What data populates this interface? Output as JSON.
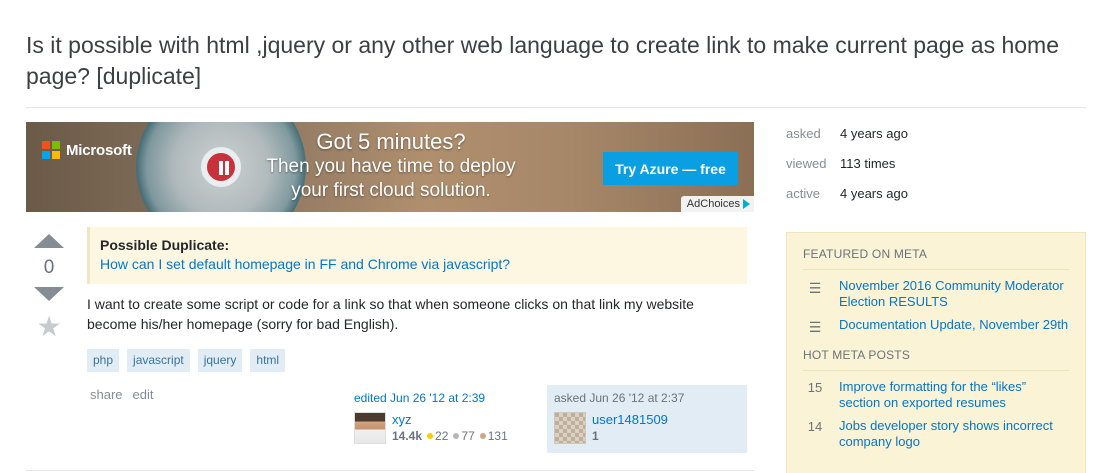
{
  "question": {
    "title": "Is it possible with html ,jquery or any other web language to create link to make current page as home page? [duplicate]",
    "votes": "0",
    "duplicate_label": "Possible Duplicate:",
    "duplicate_link": "How can I set default homepage in FF and Chrome via javascript?",
    "body": "I want to create some script or code for a link so that when someone clicks on that link my website become his/her homepage (sorry for bad English).",
    "tags": [
      "php",
      "javascript",
      "jquery",
      "html"
    ],
    "menu": {
      "share": "share",
      "edit": "edit"
    }
  },
  "ad": {
    "brand": "Microsoft",
    "line1": "Got 5 minutes?",
    "line2": "Then you have time to deploy",
    "line3": "your first cloud solution.",
    "cta": "Try Azure — free",
    "choices": "AdChoices"
  },
  "edited": {
    "action": "edited Jun 26 '12 at 2:39",
    "user": "xyz",
    "rep": "14.4k",
    "gold": "22",
    "silver": "77",
    "bronze": "131"
  },
  "asked": {
    "action": "asked Jun 26 '12 at 2:37",
    "user": "user1481509",
    "rep": "1"
  },
  "stats": {
    "asked_label": "asked",
    "asked_value": "4 years ago",
    "viewed_label": "viewed",
    "viewed_value": "113 times",
    "active_label": "active",
    "active_value": "4 years ago"
  },
  "meta": {
    "featured_heading": "FEATURED ON META",
    "featured": [
      {
        "title": "November 2016 Community Moderator Election RESULTS",
        "icon": "stackexchange-icon"
      },
      {
        "title": "Documentation Update, November 29th",
        "icon": "stackexchange-icon"
      }
    ],
    "hot_heading": "HOT META POSTS",
    "hot": [
      {
        "count": "15",
        "title": "Improve formatting for the “likes” section on exported resumes"
      },
      {
        "count": "14",
        "title": "Jobs developer story shows incorrect company logo"
      }
    ]
  },
  "colors": {
    "link": "#0077cc",
    "gold": "#ffcc01",
    "silver": "#b4b8bc",
    "bronze": "#d1a684",
    "ad_cta": "#0a9ee2"
  }
}
